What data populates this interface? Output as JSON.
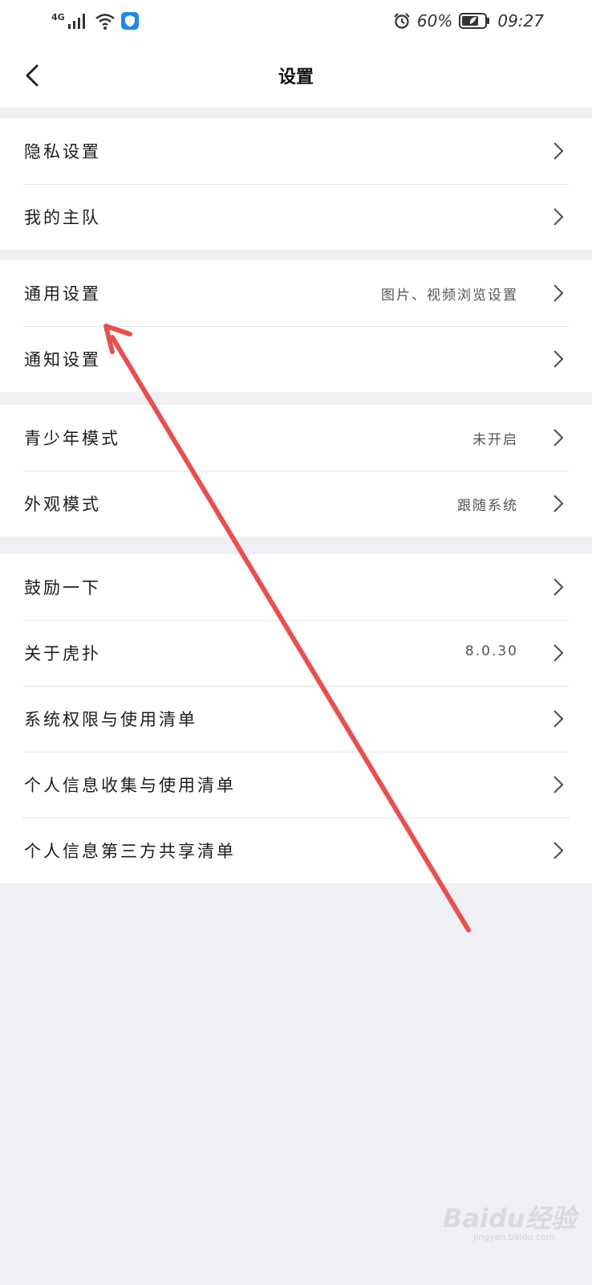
{
  "status_bar": {
    "network": "4G",
    "battery": "60%",
    "time": "09:27",
    "icons": [
      "signal-icon",
      "wifi-icon",
      "shield-app-icon",
      "alarm-icon",
      "battery-icon"
    ]
  },
  "header": {
    "title": "设置",
    "back_icon": "chevron-left-icon"
  },
  "groups": [
    {
      "items": [
        {
          "label": "隐私设置",
          "value": ""
        },
        {
          "label": "我的主队",
          "value": ""
        }
      ]
    },
    {
      "items": [
        {
          "label": "通用设置",
          "value": "图片、视频浏览设置"
        },
        {
          "label": "通知设置",
          "value": ""
        }
      ]
    },
    {
      "items": [
        {
          "label": "青少年模式",
          "value": "未开启"
        },
        {
          "label": "外观模式",
          "value": "跟随系统"
        }
      ]
    },
    {
      "items": [
        {
          "label": "鼓励一下",
          "value": ""
        },
        {
          "label": "关于虎扑",
          "value": "8.0.30"
        },
        {
          "label": "系统权限与使用清单",
          "value": ""
        },
        {
          "label": "个人信息收集与使用清单",
          "value": ""
        },
        {
          "label": "个人信息第三方共享清单",
          "value": ""
        }
      ]
    }
  ],
  "watermark": {
    "text": "Baidu经验",
    "sub": "jingyan.baidu.com"
  },
  "colors": {
    "page_bg": "#eef0f4",
    "card_bg": "#ffffff",
    "annotation_arrow": "#e8504f"
  }
}
